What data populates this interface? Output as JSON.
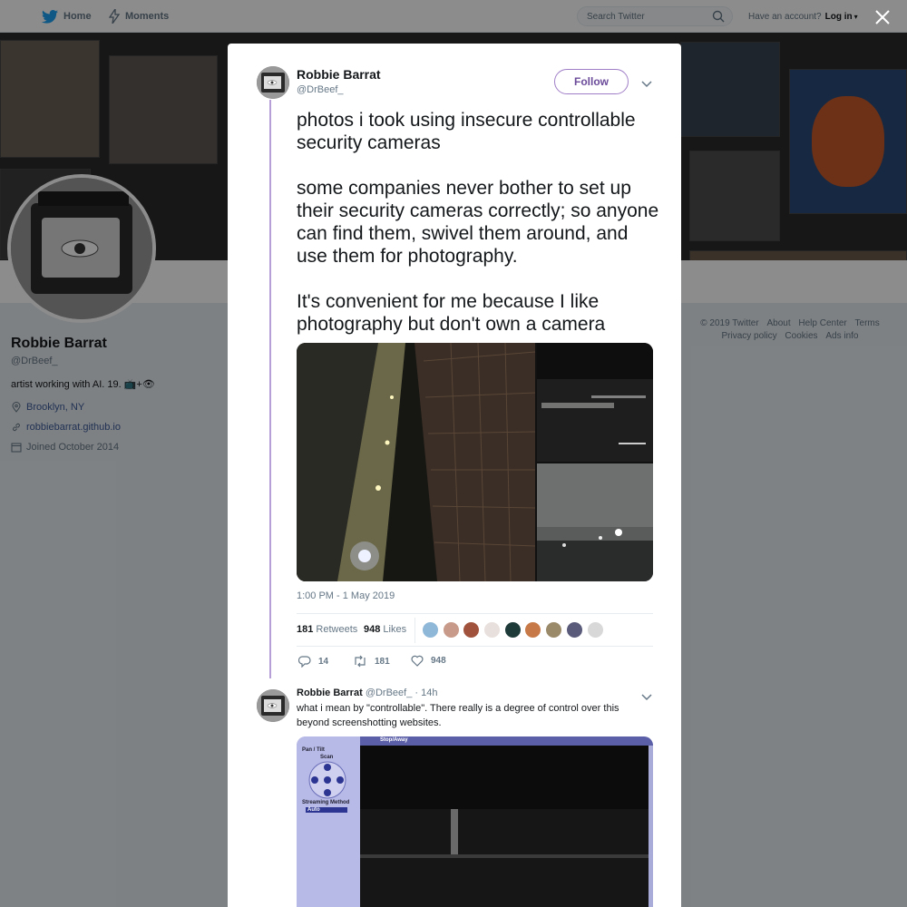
{
  "nav": {
    "home": "Home",
    "moments": "Moments",
    "search_placeholder": "Search Twitter",
    "have_account": "Have an account?",
    "login": "Log in"
  },
  "profile": {
    "name": "Robbie Barrat",
    "handle": "@DrBeef_",
    "bio": "artist working with AI. 19. 📺+👁",
    "location": "Brooklyn, NY",
    "website": "robbiebarrat.github.io",
    "joined": "Joined October 2014"
  },
  "footer": {
    "line1": [
      "© 2019 Twitter",
      "About",
      "Help Center",
      "Terms"
    ],
    "line2": [
      "Privacy policy",
      "Cookies",
      "Ads info"
    ]
  },
  "tweet": {
    "author_name": "Robbie Barrat",
    "author_handle": "@DrBeef_",
    "follow_label": "Follow",
    "text": "photos i took using insecure controllable security cameras\n\nsome companies never bother to set up their security cameras correctly; so anyone can find them, swivel them around, and use them for photography.\n\nIt's convenient for me because I like photography but don't own a camera",
    "timestamp": "1:00 PM - 1 May 2019",
    "retweets_count": "181",
    "retweets_label": "Retweets",
    "likes_count": "948",
    "likes_label": "Likes",
    "reply_count": "14",
    "retweet_action_count": "181",
    "like_action_count": "948",
    "liker_colors": [
      "#8fb8d8",
      "#c89a8a",
      "#a0523c",
      "#e8e0dc",
      "#1e3b3a",
      "#c77a48",
      "#9a8a6a",
      "#5a5a7a",
      "#d8d8d8"
    ]
  },
  "reply": {
    "author_name": "Robbie Barrat",
    "author_handle": "@DrBeef_",
    "time": "· 14h",
    "text": "what i mean by \"controllable\". There really is a degree of control over this beyond screenshotting websites.",
    "media_labels": {
      "pan": "Pan / Tilt",
      "scan": "Scan",
      "streaming": "Streaming Method",
      "auto": "Auto",
      "stop": "Stop/Away"
    }
  },
  "colors": {
    "accent": "#6b4b9a",
    "thread_line": "#b69ed6",
    "link": "#3b5998"
  }
}
